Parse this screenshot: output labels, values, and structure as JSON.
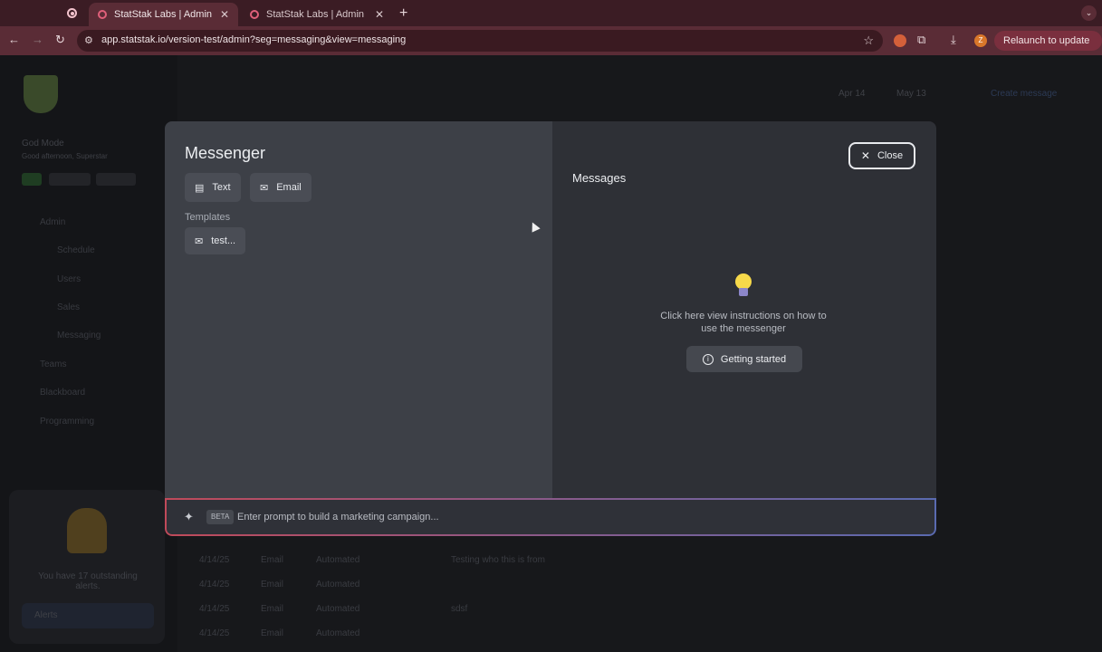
{
  "browser": {
    "tabs": [
      {
        "title": "StatStak Labs | Admin",
        "active": true
      },
      {
        "title": "StatStak Labs | Admin",
        "active": false
      }
    ],
    "url": "app.statstak.io/version-test/admin?seg=messaging&view=messaging",
    "relaunch_label": "Relaunch to update",
    "profile_initial": "Z"
  },
  "background": {
    "date_from": "Apr 14",
    "date_to": "May 13",
    "create_label": "Create message",
    "user_mode": "God Mode",
    "greeting": "Good afternoon, Superstar",
    "nav": [
      "Admin",
      "Schedule",
      "Users",
      "Sales",
      "Messaging",
      "Teams",
      "Blackboard",
      "Programming"
    ],
    "alerts_text": "You have 17 outstanding alerts.",
    "alerts_button": "Alerts",
    "rows": [
      {
        "date": "4/14/25",
        "type": "Email",
        "kind": "Automated",
        "note": "Testing who this is from"
      },
      {
        "date": "4/14/25",
        "type": "Email",
        "kind": "Automated",
        "note": ""
      },
      {
        "date": "4/14/25",
        "type": "Email",
        "kind": "Automated",
        "note": "sdsf"
      },
      {
        "date": "4/14/25",
        "type": "Email",
        "kind": "Automated",
        "note": ""
      }
    ]
  },
  "messenger": {
    "title": "Messenger",
    "text_btn": "Text",
    "email_btn": "Email",
    "templates_label": "Templates",
    "template_item": "test...",
    "messages_title": "Messages",
    "close_label": "Close",
    "hint": "Click here view instructions on how to use the messenger",
    "getting_started": "Getting started",
    "beta_badge": "BETA",
    "prompt_placeholder": "Enter prompt to build a marketing campaign..."
  }
}
